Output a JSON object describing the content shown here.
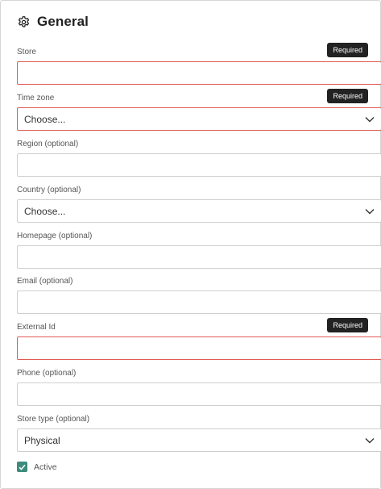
{
  "header": {
    "title": "General",
    "icon": "gear-icon"
  },
  "required_badge": "Required",
  "fields": {
    "store": {
      "label": "Store",
      "value": ""
    },
    "time_zone": {
      "label": "Time zone",
      "value": "Choose..."
    },
    "region": {
      "label": "Region (optional)",
      "value": ""
    },
    "country": {
      "label": "Country (optional)",
      "value": "Choose..."
    },
    "homepage": {
      "label": "Homepage (optional)",
      "value": ""
    },
    "email": {
      "label": "Email (optional)",
      "value": ""
    },
    "external_id": {
      "label": "External Id",
      "value": ""
    },
    "phone": {
      "label": "Phone (optional)",
      "value": ""
    },
    "store_type": {
      "label": "Store type (optional)",
      "value": "Physical"
    }
  },
  "active": {
    "label": "Active",
    "checked": true
  },
  "colors": {
    "error_border": "#e05b55",
    "checkbox": "#3c8c7d",
    "badge": "#222222"
  }
}
